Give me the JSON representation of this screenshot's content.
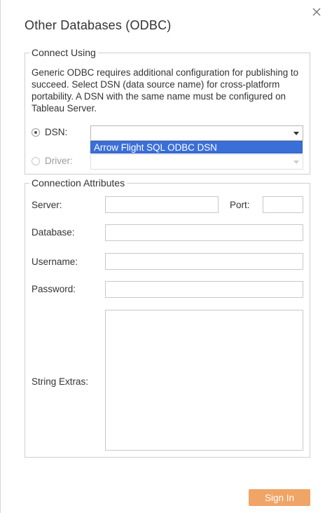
{
  "dialog": {
    "title": "Other Databases (ODBC)",
    "close_glyph": "╳",
    "close_icon": "close-icon"
  },
  "connect_using": {
    "legend": "Connect Using",
    "description": "Generic ODBC requires additional configuration for publishing to succeed. Select DSN (data source name) for cross-platform portability. A DSN with the same name must be configured on Tableau Server.",
    "dsn_label": "DSN:",
    "dsn_selected": true,
    "dsn_value": "",
    "dsn_options": [
      "Arrow Flight SQL ODBC DSN"
    ],
    "driver_label": "Driver:",
    "driver_selected": false,
    "driver_enabled": false
  },
  "connection_attributes": {
    "legend": "Connection Attributes",
    "server_label": "Server:",
    "server_value": "",
    "port_label": "Port:",
    "port_value": "",
    "database_label": "Database:",
    "database_value": "",
    "username_label": "Username:",
    "username_value": "",
    "password_label": "Password:",
    "password_value": "",
    "string_extras_label": "String Extras:",
    "string_extras_value": ""
  },
  "footer": {
    "sign_in_label": "Sign In"
  },
  "colors": {
    "accent_button": "#f0a465",
    "dropdown_highlight": "#3a6fd8"
  }
}
